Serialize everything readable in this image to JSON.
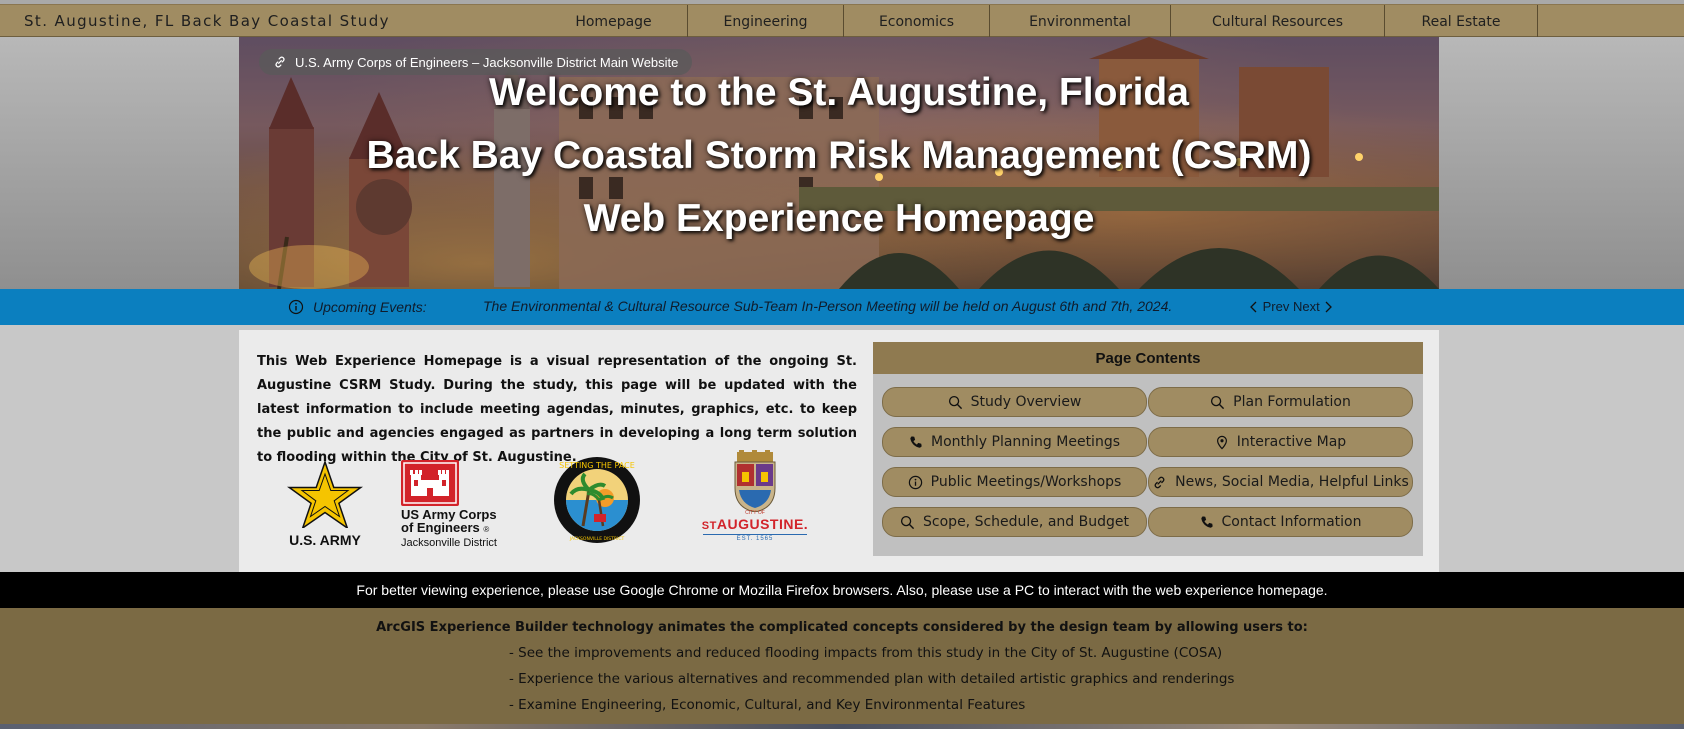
{
  "nav": {
    "site_title": "St. Augustine, FL Back Bay Coastal Study",
    "items": [
      {
        "label": "Homepage"
      },
      {
        "label": "Engineering"
      },
      {
        "label": "Economics"
      },
      {
        "label": "Environmental"
      },
      {
        "label": "Cultural Resources"
      },
      {
        "label": "Real Estate"
      }
    ]
  },
  "hero": {
    "link_label": "U.S. Army Corps of Engineers – Jacksonville District Main Website",
    "title_lines": [
      "Welcome to the St. Augustine, Florida",
      "Back Bay Coastal Storm Risk Management (CSRM)",
      "Web Experience Homepage"
    ]
  },
  "events": {
    "label": "Upcoming Events:",
    "text": "The Environmental & Cultural Resource Sub-Team In-Person Meeting will be held on August 6th and 7th, 2024.",
    "prev_label": "Prev",
    "next_label": "Next"
  },
  "intro": {
    "text": "This Web Experience Homepage is a visual representation of the ongoing St. Augustine CSRM Study. During the study, this page will be updated with the latest information to include meeting agendas, minutes, graphics, etc. to keep the public and agencies engaged as partners in developing a long term solution to flooding within the City of St. Augustine."
  },
  "logos": {
    "army": "U.S. ARMY",
    "usace_line1": "US Army Corps",
    "usace_line2": "of Engineers",
    "usace_registered": "®",
    "usace_district": "Jacksonville District",
    "pace_ring": "SETTING THE PACE",
    "pace_bottom": "JACKSONVILLE DISTRICT",
    "city_of": "CITY OF",
    "st_prefix": "ST",
    "city_name": "AUGUSTINE.",
    "est": "EST. 1565"
  },
  "contents": {
    "title": "Page Contents",
    "links": [
      {
        "label": "Study Overview",
        "icon": "search-icon"
      },
      {
        "label": "Plan Formulation",
        "icon": "search-icon"
      },
      {
        "label": "Monthly Planning Meetings",
        "icon": "phone-icon"
      },
      {
        "label": "Interactive Map",
        "icon": "map-pin-icon"
      },
      {
        "label": "Public Meetings/Workshops",
        "icon": "info-icon"
      },
      {
        "label": "News, Social Media, Helpful Links",
        "icon": "link-icon"
      },
      {
        "label": "Scope, Schedule, and Budget",
        "icon": "search-icon"
      },
      {
        "label": "Contact Information",
        "icon": "phone-icon"
      }
    ]
  },
  "notice": {
    "text": "For better viewing experience, please use Google Chrome or Mozilla Firefox browsers. Also, please use a PC to interact with the web experience homepage."
  },
  "bottom": {
    "heading": "ArcGIS Experience Builder technology animates the complicated concepts considered by the design team by allowing users to:",
    "bullets": [
      "- See the improvements and reduced flooding impacts from this study in the City of St. Augustine (COSA)",
      "- Experience the various alternatives and recommended plan with detailed artistic graphics and renderings",
      "- Examine Engineering, Economic, Cultural, and Key Environmental Features"
    ]
  },
  "colors": {
    "nav_tan": "#a08c62",
    "events_blue": "#0b7fbf",
    "bottom_brown": "#7b6a44",
    "usace_red": "#d2232a",
    "army_gold": "#f5c400"
  }
}
